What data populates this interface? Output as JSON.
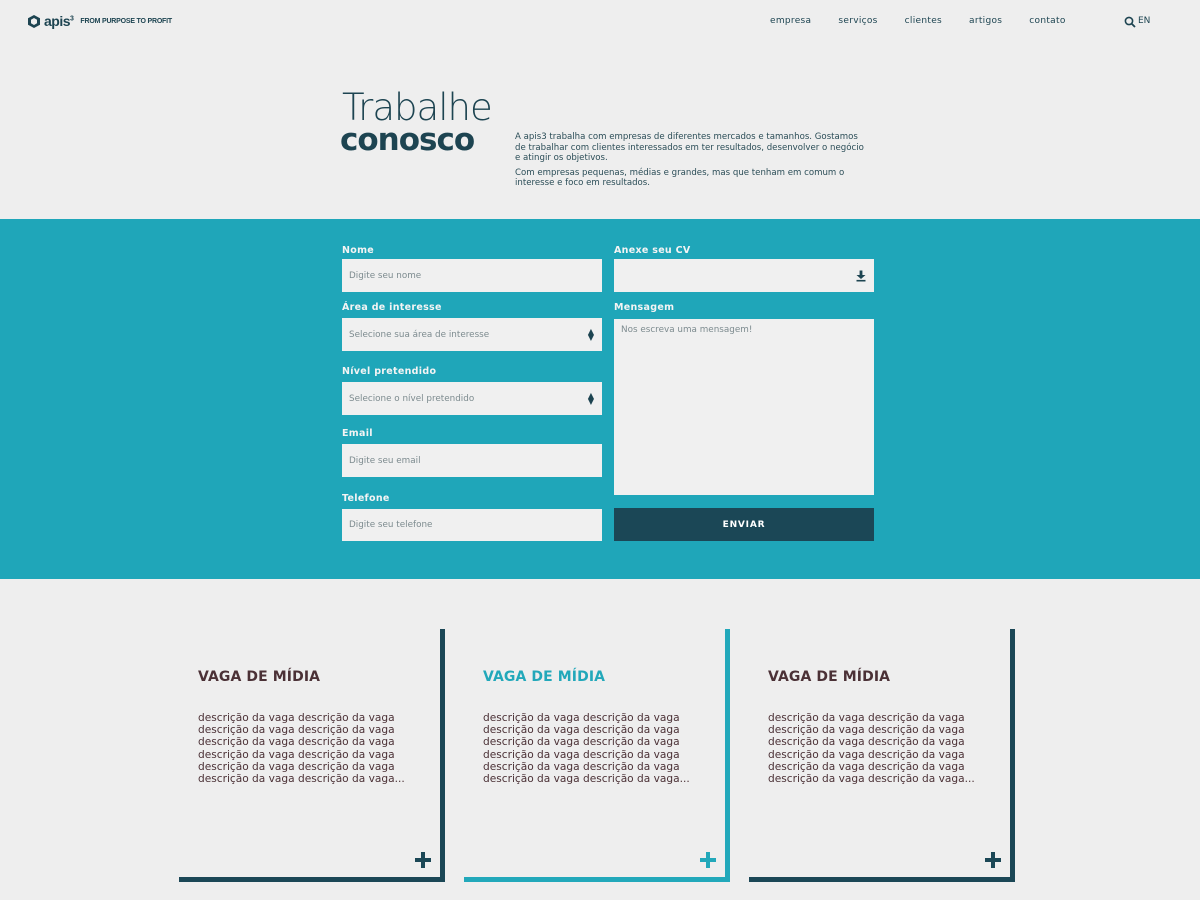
{
  "header": {
    "logo_word": "apis",
    "logo_sup": "3",
    "tagline": "FROM PURPOSE TO PROFIT",
    "nav": [
      "empresa",
      "serviços",
      "clientes",
      "artigos",
      "contato"
    ],
    "lang": "EN"
  },
  "hero": {
    "title_light": "Trabalhe",
    "title_bold": "conosco",
    "paragraph1": "A apis3 trabalha com empresas de diferentes mercados e tamanhos. Gostamos de trabalhar com clientes interessados em ter resultados, desenvolver o negócio e atingir os objetivos.",
    "paragraph2": "Com empresas pequenas, médias e grandes, mas que tenham em comum o interesse e foco em resultados."
  },
  "form": {
    "name_label": "Nome",
    "name_placeholder": "Digite seu nome",
    "area_label": "Área de interesse",
    "area_placeholder": "Selecione sua área de interesse",
    "level_label": "Nível pretendido",
    "level_placeholder": "Selecione o nível pretendido",
    "email_label": "Email",
    "email_placeholder": "Digite seu email",
    "phone_label": "Telefone",
    "phone_placeholder": "Digite seu telefone",
    "cv_label": "Anexe seu CV",
    "message_label": "Mensagem",
    "message_placeholder": "Nos escreva uma mensagem!",
    "submit_label": "ENVIAR"
  },
  "jobs": [
    {
      "title": "VAGA DE MÍDIA",
      "description": "descrição da vaga descrição da vaga descrição da vaga descrição da vaga descrição da vaga descrição da vaga descrição da vaga descrição da vaga descrição da vaga descrição da vaga descrição da vaga descrição da vaga..."
    },
    {
      "title": "VAGA DE MÍDIA",
      "description": "descrição da vaga descrição da vaga descrição da vaga descrição da vaga descrição da vaga descrição da vaga descrição da vaga descrição da vaga descrição da vaga descrição da vaga descrição da vaga descrição da vaga..."
    },
    {
      "title": "VAGA DE MÍDIA",
      "description": "descrição da vaga descrição da vaga descrição da vaga descrição da vaga descrição da vaga descrição da vaga descrição da vaga descrição da vaga descrição da vaga descrição da vaga descrição da vaga descrição da vaga..."
    }
  ],
  "colors": {
    "primary_dark": "#1b4756",
    "accent_teal": "#1fa6b9",
    "background": "#eeeeee",
    "card_text": "#4b3136"
  }
}
